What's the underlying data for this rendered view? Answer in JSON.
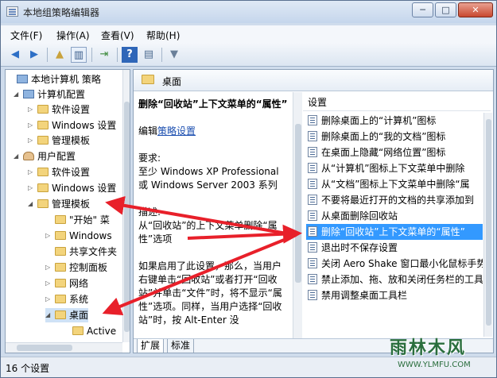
{
  "window": {
    "title": "本地组策略编辑器",
    "controls": {
      "min": "─",
      "max": "□",
      "close": "✕"
    }
  },
  "menu": [
    "文件(F)",
    "操作(A)",
    "查看(V)",
    "帮助(H)"
  ],
  "toolbar": {
    "icons": [
      "back-icon",
      "forward-icon",
      "up-folder-icon",
      "show-hide-tree-icon",
      "export-list-icon",
      "help-icon",
      "properties-icon",
      "filter-icon"
    ]
  },
  "tree": [
    {
      "label": "本地计算机 策略",
      "level": 0,
      "icon": "policy-icon"
    },
    {
      "label": "计算机配置",
      "level": 1,
      "icon": "computer-icon"
    },
    {
      "label": "软件设置",
      "level": 2,
      "icon": "folder-icon"
    },
    {
      "label": "Windows 设置",
      "level": 2,
      "icon": "folder-icon"
    },
    {
      "label": "管理模板",
      "level": 2,
      "icon": "folder-icon"
    },
    {
      "label": "用户配置",
      "level": 1,
      "icon": "user-icon"
    },
    {
      "label": "软件设置",
      "level": 2,
      "icon": "folder-icon"
    },
    {
      "label": "Windows 设置",
      "level": 2,
      "icon": "folder-icon"
    },
    {
      "label": "管理模板",
      "level": 2,
      "icon": "folder-icon"
    },
    {
      "label": "\"开始\" 菜",
      "level": 3,
      "icon": "folder-icon"
    },
    {
      "label": "Windows",
      "level": 3,
      "icon": "folder-icon"
    },
    {
      "label": "共享文件夹",
      "level": 3,
      "icon": "folder-icon"
    },
    {
      "label": "控制面板",
      "level": 3,
      "icon": "folder-icon"
    },
    {
      "label": "网络",
      "level": 3,
      "icon": "folder-icon"
    },
    {
      "label": "系统",
      "level": 3,
      "icon": "folder-icon"
    },
    {
      "label": "桌面",
      "level": 3,
      "icon": "folder-icon"
    },
    {
      "label": "Active",
      "level": 4,
      "icon": "folder-icon"
    }
  ],
  "right": {
    "header": "桌面",
    "desc": {
      "title": "删除“回收站”上下文菜单的“属性”",
      "edit_prefix": "编辑",
      "edit_link": "策略设置",
      "req_label": "要求:",
      "req_text": "至少 Windows XP Professional 或 Windows Server 2003 系列",
      "desc_label": "描述:",
      "desc_text": "从“回收站”的上下文菜单删除“属性”选项",
      "body_text": "如果启用了此设置，那么，当用户右键单击“回收站”或者打开“回收站”并单击“文件”时，将不显示“属性”选项。同样，当用户选择“回收站”时，按 Alt-Enter 没"
    },
    "list_header": "设置",
    "items": [
      "删除桌面上的“计算机”图标",
      "删除桌面上的“我的文档”图标",
      "在桌面上隐藏“网络位置”图标",
      "从“计算机”图标上下文菜单中删除",
      "从“文档”图标上下文菜单中删除“属",
      "不要将最近打开的文档的共享添加到",
      "从桌面删除回收站",
      "删除“回收站”上下文菜单的“属性”",
      "退出时不保存设置",
      "关闭 Aero Shake 窗口最小化鼠标手势",
      "禁止添加、拖、放和关闭任务栏的工具",
      "禁用调整桌面工具栏"
    ],
    "selected_index": 7,
    "tabs": [
      "扩展",
      "标准"
    ]
  },
  "status": "16 个设置",
  "watermark": {
    "cn": "雨林木风",
    "en": "WWW.YLMFU.COM"
  },
  "colors": {
    "selection": "#3399ff",
    "arrow": "#e8202a",
    "link": "#1c4fb0"
  }
}
